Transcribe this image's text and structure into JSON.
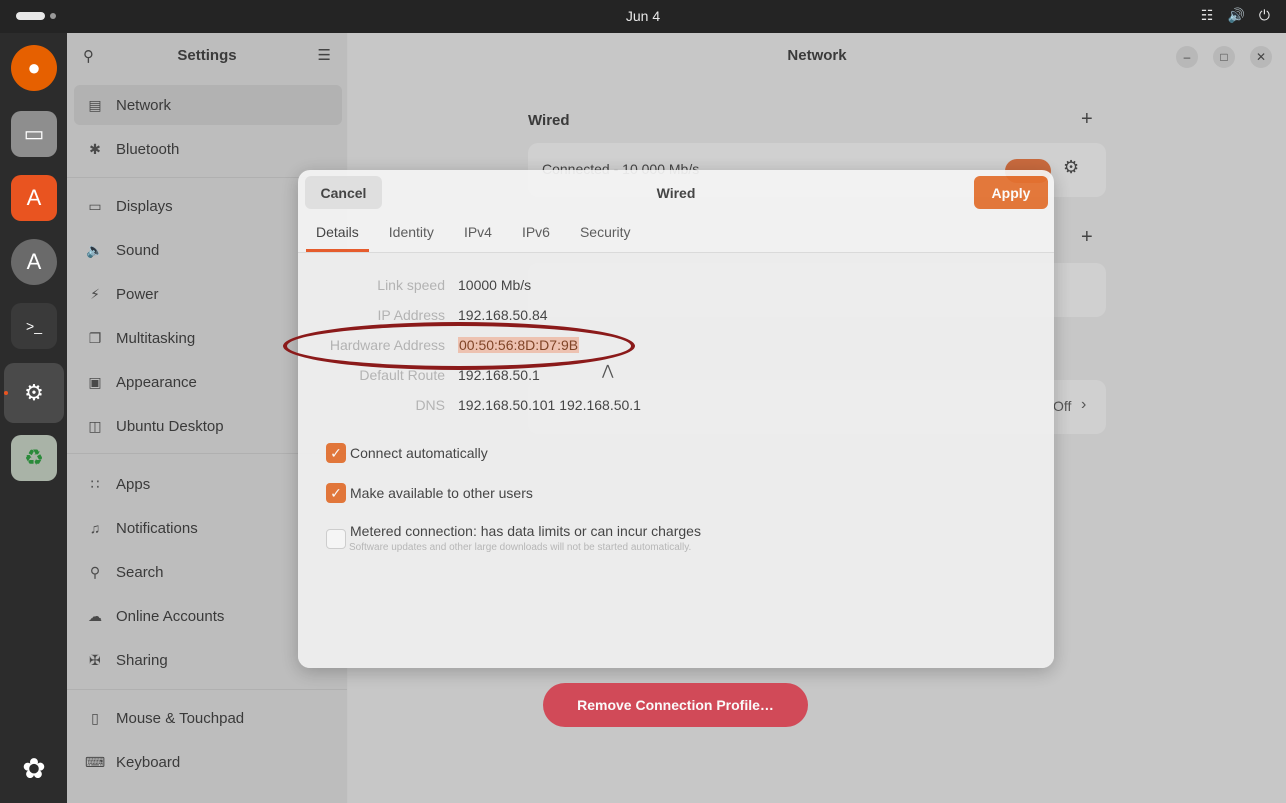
{
  "topbar": {
    "clock": "Jun 4",
    "tray_icons": [
      "network-icon",
      "volume-icon",
      "power-icon"
    ]
  },
  "dock": {
    "apps": [
      "firefox",
      "files",
      "app-center",
      "software-updater",
      "terminal",
      "settings",
      "trash"
    ],
    "bottom": "show-apps"
  },
  "sidebar": {
    "title": "Settings",
    "items": [
      {
        "label": "Network",
        "icon": "network-icon"
      },
      {
        "label": "Bluetooth",
        "icon": "bluetooth-icon"
      },
      {
        "label": "Displays",
        "icon": "display-icon"
      },
      {
        "label": "Sound",
        "icon": "sound-icon"
      },
      {
        "label": "Power",
        "icon": "power-icon"
      },
      {
        "label": "Multitasking",
        "icon": "multitasking-icon"
      },
      {
        "label": "Appearance",
        "icon": "appearance-icon"
      },
      {
        "label": "Ubuntu Desktop",
        "icon": "desktop-icon"
      },
      {
        "label": "Apps",
        "icon": "apps-icon"
      },
      {
        "label": "Notifications",
        "icon": "bell-icon"
      },
      {
        "label": "Search",
        "icon": "search-icon"
      },
      {
        "label": "Online Accounts",
        "icon": "cloud-icon"
      },
      {
        "label": "Sharing",
        "icon": "share-icon"
      },
      {
        "label": "Mouse & Touchpad",
        "icon": "mouse-icon"
      },
      {
        "label": "Keyboard",
        "icon": "keyboard-icon"
      }
    ]
  },
  "main": {
    "title": "Network",
    "wired_label": "Wired",
    "wired_status": "Connected - 10 000 Mb/s",
    "proxy_value_fragment": "Off"
  },
  "dialog": {
    "title": "Wired",
    "cancel_label": "Cancel",
    "apply_label": "Apply",
    "tabs": [
      "Details",
      "Identity",
      "IPv4",
      "IPv6",
      "Security"
    ],
    "details": {
      "link_speed_label": "Link speed",
      "link_speed": "10000 Mb/s",
      "ip_label": "IP Address",
      "ip": "192.168.50.84",
      "hw_label": "Hardware Address",
      "hw": "00:50:56:8D:D7:9B",
      "route_label": "Default Route",
      "route": "192.168.50.1",
      "dns_label": "DNS",
      "dns": "192.168.50.101 192.168.50.1"
    },
    "connect_auto": "Connect automatically",
    "available_users": "Make available to other users",
    "metered": "Metered connection: has data limits or can incur charges",
    "metered_sub": "Software updates and other large downloads will not be started automatically.",
    "remove_label": "Remove Connection Profile…"
  },
  "colors": {
    "accent": "#e95420",
    "apply": "#e5712f",
    "remove": "#d2404f",
    "annotation": "#8b1a1a"
  }
}
